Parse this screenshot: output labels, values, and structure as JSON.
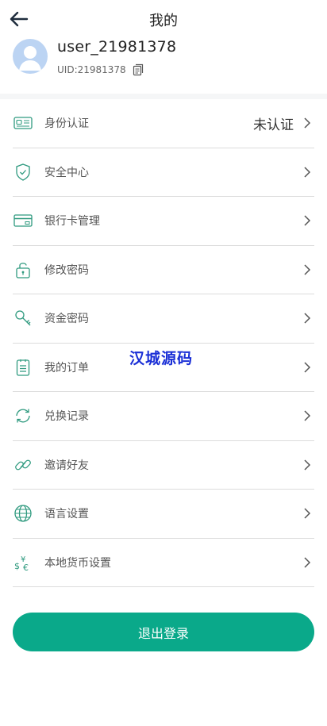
{
  "header": {
    "title": "我的"
  },
  "profile": {
    "username": "user_21981378",
    "uid": "UID:21981378"
  },
  "menu": {
    "items": [
      {
        "label": "身份认证",
        "value": "未认证",
        "icon": "id-card-icon"
      },
      {
        "label": "安全中心",
        "value": "",
        "icon": "shield-icon"
      },
      {
        "label": "银行卡管理",
        "value": "",
        "icon": "bank-card-icon"
      },
      {
        "label": "修改密码",
        "value": "",
        "icon": "lock-icon"
      },
      {
        "label": "资金密码",
        "value": "",
        "icon": "key-icon"
      },
      {
        "label": "我的订单",
        "value": "",
        "icon": "order-list-icon"
      },
      {
        "label": "兑换记录",
        "value": "",
        "icon": "refresh-icon"
      },
      {
        "label": "邀请好友",
        "value": "",
        "icon": "link-icon"
      },
      {
        "label": "语言设置",
        "value": "",
        "icon": "globe-icon"
      },
      {
        "label": "本地货币设置",
        "value": "",
        "icon": "currency-icon"
      }
    ]
  },
  "watermark": "汉城源码",
  "logout": {
    "label": "退出登录"
  },
  "colors": {
    "accent": "#0aa98a",
    "icon": "#2f9a7f",
    "avatar": "#bcd4f3"
  }
}
